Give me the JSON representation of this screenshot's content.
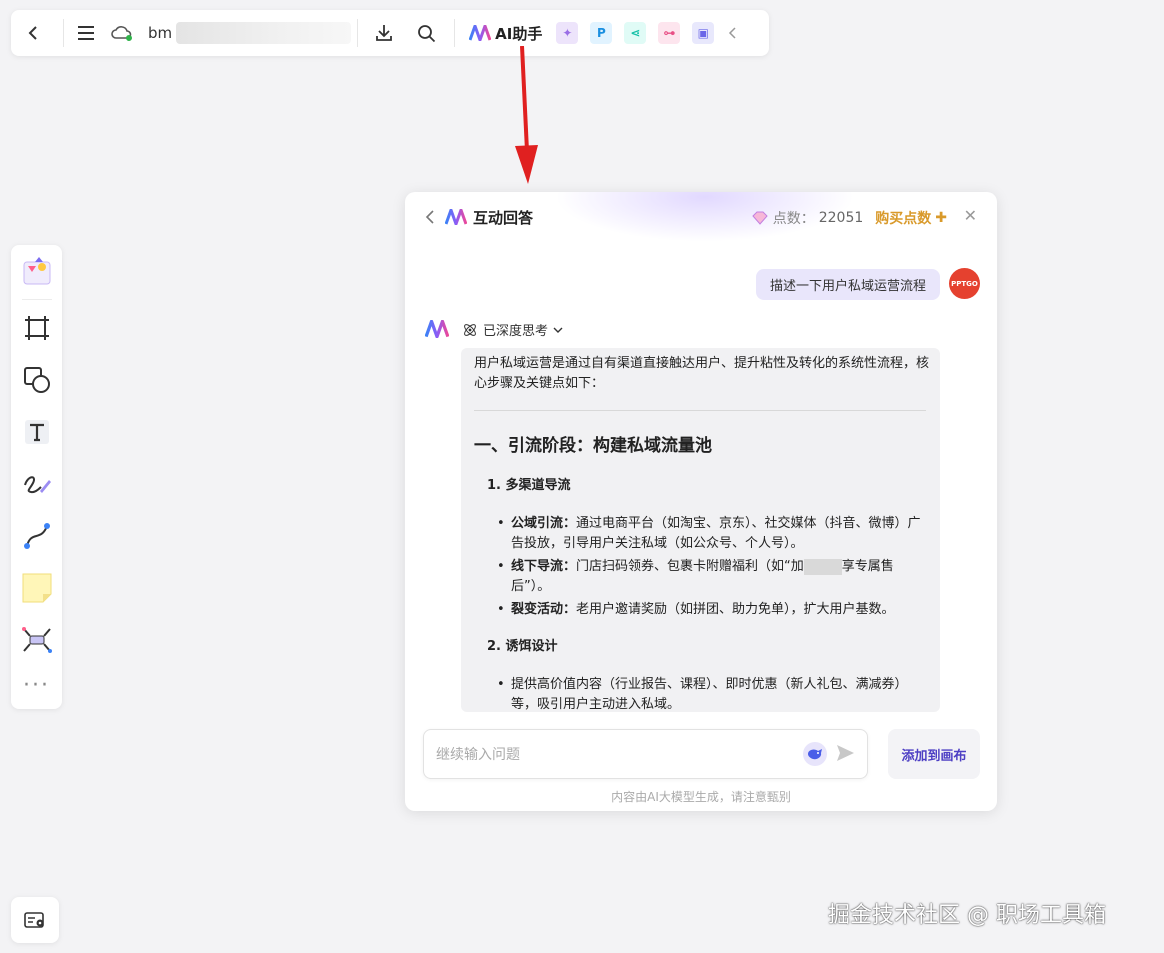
{
  "toolbar": {
    "filename_prefix": "bm",
    "ai_label": "AI助手",
    "apps": [
      {
        "name": "image-ai-icon",
        "glyph": "✦",
        "bg": "#ede4fb",
        "color": "#9a6ee6"
      },
      {
        "name": "p-app-icon",
        "glyph": "P",
        "bg": "#e1f3ff",
        "color": "#1a8fe0"
      },
      {
        "name": "share-app-icon",
        "glyph": "⋖",
        "bg": "#e0fbf6",
        "color": "#16c1a8"
      },
      {
        "name": "mindmap-app-icon",
        "glyph": "⊶",
        "bg": "#fde5ee",
        "color": "#e85086"
      },
      {
        "name": "chat-app-icon",
        "glyph": "▣",
        "bg": "#e8e8fc",
        "color": "#6a66e8"
      }
    ]
  },
  "panel": {
    "title": "互动回答",
    "points_label": "点数：",
    "points_value": "22051",
    "buy_label": "购买点数",
    "user_message": "描述一下用户私域运营流程",
    "avatar_text": "PPTGO",
    "think_label": "已深度思考",
    "answer": {
      "intro": "用户私域运营是通过自有渠道直接触达用户、提升粘性及转化的系统性流程，核心步骤及关键点如下：",
      "heading": "一、引流阶段：构建私域流量池",
      "sections": [
        {
          "title": "1. 多渠道导流",
          "items": [
            {
              "bold": "公域引流：",
              "text": "通过电商平台（如淘宝、京东）、社交媒体（抖音、微博）广告投放，引导用户关注私域（如公众号、个人号）。"
            },
            {
              "bold": "线下导流：",
              "text": "门店扫码领券、包裹卡附赠福利（如“加",
              "text2": "享专属售后”）。"
            },
            {
              "bold": "裂变活动：",
              "text": "老用户邀请奖励（如拼团、助力免单），扩大用户基数。"
            }
          ]
        },
        {
          "title": "2. 诱饵设计",
          "items": [
            {
              "bold": "",
              "text": "提供高价值内容（行业报告、课程）、即时优惠（新人礼包、满减券）等，吸引用户主动进入私域。"
            }
          ]
        }
      ]
    },
    "input_placeholder": "继续输入问题",
    "add_button": "添加到画布",
    "disclaimer": "内容由AI大模型生成，请注意甄别"
  },
  "watermark": "掘金技术社区 @ 职场工具箱",
  "colors": {
    "accent": "#4d3fc4",
    "arrow": "#e02020",
    "buy": "#d99a2b"
  }
}
